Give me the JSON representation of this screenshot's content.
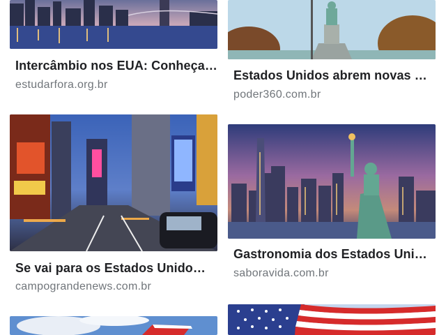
{
  "results": [
    {
      "title": "Intercâmbio nos EUA: Conheça…",
      "domain": "estudarfora.org.br",
      "image": "nyc-skyline-night-bridge"
    },
    {
      "title": "Estados Unidos abrem novas …",
      "domain": "poder360.com.br",
      "image": "statue-of-liberty-trees"
    },
    {
      "title": "Se vai para os Estados Unido…",
      "domain": "campograndenews.com.br",
      "image": "times-square-night"
    },
    {
      "title": "Gastronomia dos Estados Uni…",
      "domain": "saboravida.com.br",
      "image": "statue-of-liberty-skyline-dusk"
    },
    {
      "title": "",
      "domain": "",
      "image": "american-flag-blue-sky"
    },
    {
      "title": "",
      "domain": "",
      "image": "american-flag-waving"
    }
  ]
}
